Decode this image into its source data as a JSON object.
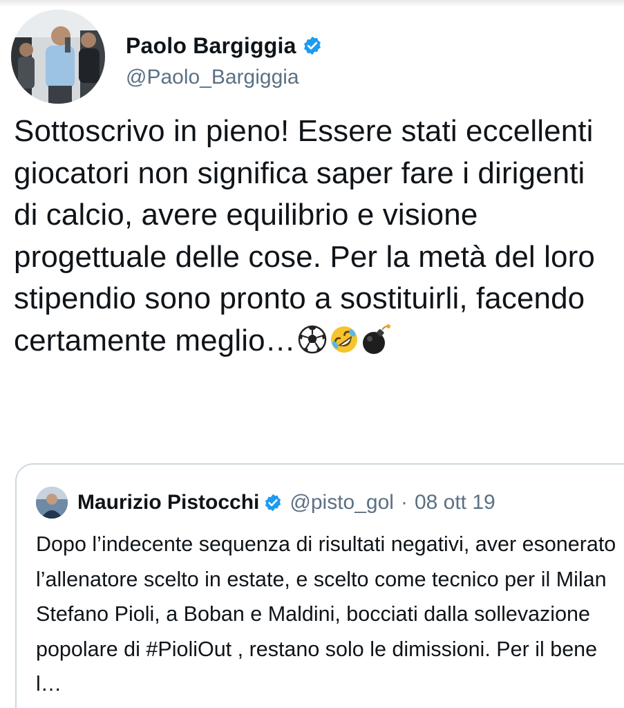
{
  "tweet": {
    "author": {
      "name": "Paolo Bargiggia",
      "handle": "@Paolo_Bargiggia",
      "verified": true
    },
    "text": "Sottoscrivo in pieno! Essere stati eccellenti giocatori non significa saper fare i dirigenti di calcio, avere equilibrio e visione progettuale delle cose. Per la metà del loro stipendio sono pronto a sostituirli, facendo certamente meglio…",
    "emojis": [
      "soccer-ball-icon",
      "rolling-on-floor-laughing-icon",
      "bomb-icon"
    ]
  },
  "quoted_tweet": {
    "author": {
      "name": "Maurizio Pistocchi",
      "handle": "@pisto_gol",
      "verified": true
    },
    "separator": "·",
    "date": "08 ott 19",
    "text": "Dopo l’indecente sequenza di risultati negativi, aver esonerato l’allenatore scelto in estate, e scelto come tecnico per il Milan Stefano Pioli, a Boban e Maldini, bocciati dalla sollevazione popolare di #PioliOut , restano solo le dimissioni. Per il bene l…"
  },
  "colors": {
    "text": "#0f1419",
    "secondary_text": "#5b7083",
    "verified_blue": "#1d9bf0",
    "card_border": "#cfd9de"
  }
}
